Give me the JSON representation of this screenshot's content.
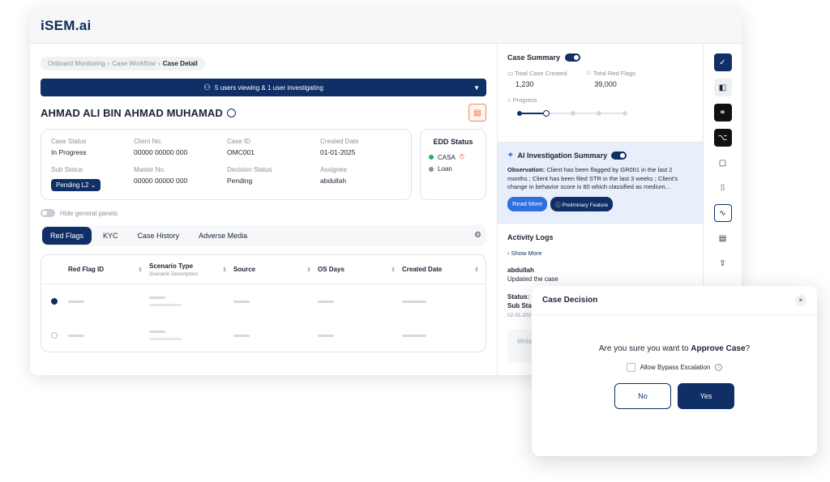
{
  "app": {
    "logo": "iSEM.ai"
  },
  "breadcrumb": [
    "Onboard Monitoring",
    "Case Workflow",
    "Case Detail"
  ],
  "viewbar": {
    "text": "5 users viewing & 1 user investigating"
  },
  "customer": {
    "name": "AHMAD ALI BIN AHMAD MUHAMAD"
  },
  "case_info": {
    "fields": [
      {
        "label": "Case Status",
        "value": "In Progress"
      },
      {
        "label": "Client No.",
        "value": "00000 00000 000"
      },
      {
        "label": "Case ID",
        "value": "OMC001"
      },
      {
        "label": "Created Date",
        "value": "01-01-2025"
      },
      {
        "label": "Sub Status",
        "value": "Pending L2"
      },
      {
        "label": "Master No.",
        "value": "00000 00000 000"
      },
      {
        "label": "Decision Status",
        "value": "Pending"
      },
      {
        "label": "Assignee",
        "value": "abdullah"
      }
    ]
  },
  "edd": {
    "title": "EDD Status",
    "items": [
      "CASA",
      "Loan"
    ]
  },
  "hide_panels": {
    "label": "Hide general panels"
  },
  "tabs": [
    "Red Flags",
    "KYC",
    "Case History",
    "Adverse Media"
  ],
  "table": {
    "headers": [
      {
        "label": "Red Flag ID",
        "sub": ""
      },
      {
        "label": "Scenario Type",
        "sub": "Scenario Description"
      },
      {
        "label": "Source",
        "sub": ""
      },
      {
        "label": "OS Days",
        "sub": ""
      },
      {
        "label": "Created Date",
        "sub": ""
      }
    ]
  },
  "summary": {
    "title": "Case Summary",
    "total_case_label": "Total Case Created",
    "total_case_value": "1,230",
    "total_flags_label": "Total Red Flags",
    "total_flags_value": "39,000",
    "progress_label": "Progress"
  },
  "ai": {
    "title": "AI Investigation Summary",
    "obs_label": "Observation:",
    "obs_text": "Client has been flagged by GR001 in the last 2 months ; Client has been filed STR in the last 3 weeks ; Client's change in behavior score is 80 which classified as medium...",
    "read_more": "Read More",
    "prelim": "Preliminary Feature"
  },
  "activity": {
    "title": "Activity Logs",
    "show_more": "Show More",
    "user": "abdullah",
    "desc": "Updated the case",
    "status_1": "Status: I",
    "status_2": "Sub Stat",
    "date": "02-01-202",
    "write_placeholder": "Write"
  },
  "modal": {
    "title": "Case Decision",
    "close": "×",
    "question_prefix": "Are you sure you want to ",
    "question_bold": "Approve Case",
    "question_suffix": "?",
    "bypass_label": "Allow Bypass Escalation",
    "no_label": "No",
    "yes_label": "Yes"
  },
  "colors": {
    "primary": "#0f2f66",
    "accent": "#2f6fe0",
    "warning": "#e76a35"
  }
}
